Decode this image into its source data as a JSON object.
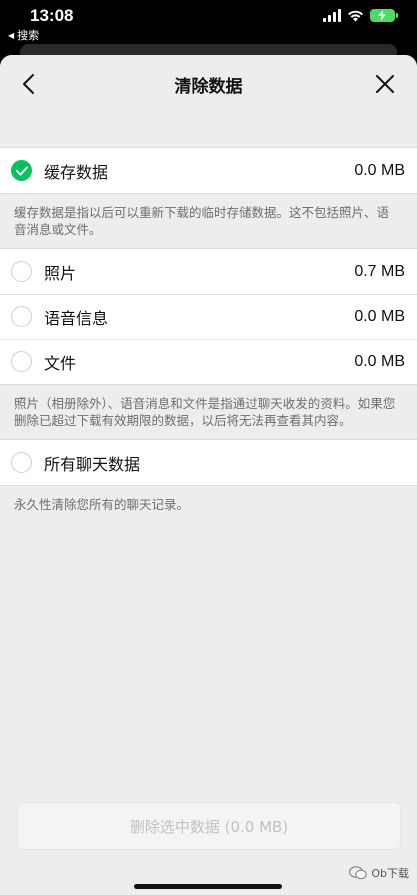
{
  "status_bar": {
    "time": "13:08",
    "back_app": "搜索"
  },
  "nav": {
    "title": "清除数据"
  },
  "groups": {
    "cache": {
      "label": "缓存数据",
      "value": "0.0 MB",
      "checked": true,
      "note": "缓存数据是指以后可以重新下载的临时存储数据。这不包括照片、语音消息或文件。"
    },
    "media": {
      "items": [
        {
          "label": "照片",
          "value": "0.7 MB",
          "checked": false
        },
        {
          "label": "语音信息",
          "value": "0.0 MB",
          "checked": false
        },
        {
          "label": "文件",
          "value": "0.0 MB",
          "checked": false
        }
      ],
      "note": "照片（相册除外）、语音消息和文件是指通过聊天收发的资料。如果您删除已超过下载有效期限的数据，以后将无法再查看其内容。"
    },
    "all_chats": {
      "label": "所有聊天数据",
      "checked": false,
      "note": "永久性清除您所有的聊天记录。"
    }
  },
  "footer": {
    "delete_button": "删除选中数据 (0.0 MB)"
  },
  "watermark": "Ob下载",
  "colors": {
    "accent_green": "#07c160",
    "sheet_bg": "#ededed"
  }
}
